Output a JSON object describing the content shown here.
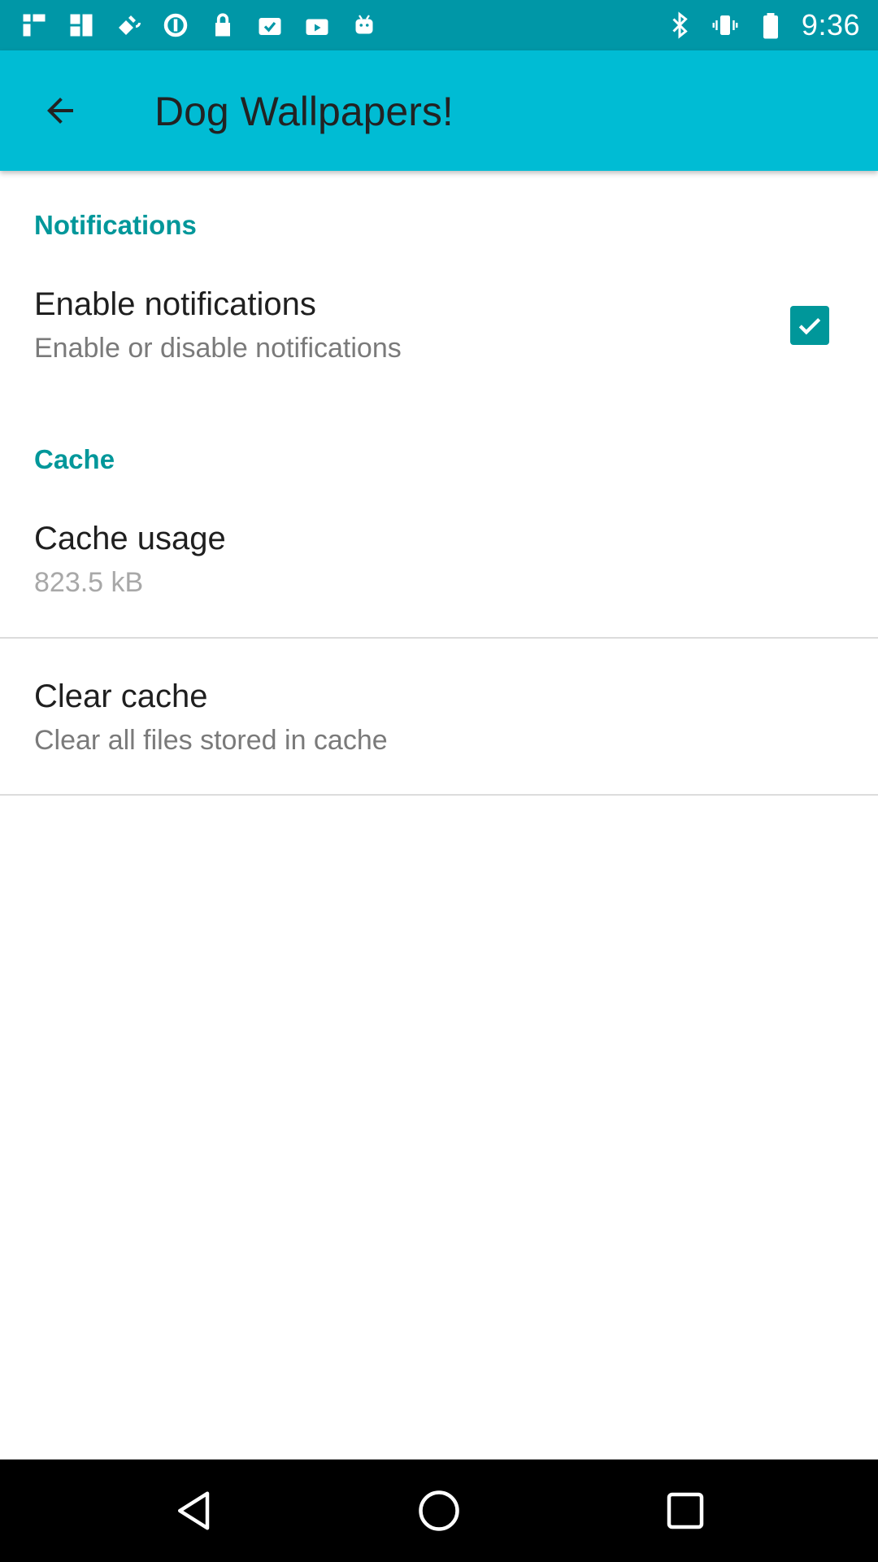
{
  "status_bar": {
    "time": "9:36",
    "left_icons": [
      "signal-icon",
      "signal-alt-icon",
      "satellite-icon",
      "data-saver-icon",
      "lock-icon",
      "task-done-icon",
      "briefcase-icon",
      "android-icon"
    ],
    "right_icons": [
      "bluetooth-icon",
      "vibrate-icon",
      "battery-icon"
    ]
  },
  "app_bar": {
    "title": "Dog Wallpapers!",
    "back_icon": "back-arrow-icon",
    "color": "#00bcd4"
  },
  "settings": {
    "notifications_header": "Notifications",
    "enable_notifications": {
      "title": "Enable notifications",
      "summary": "Enable or disable notifications",
      "checked": true
    },
    "cache_header": "Cache",
    "cache_usage": {
      "title": "Cache usage",
      "summary": "823.5 kB"
    },
    "clear_cache": {
      "title": "Clear cache",
      "summary": "Clear all files stored in cache"
    }
  },
  "nav_bar": {
    "back_icon": "nav-back-icon",
    "home_icon": "nav-home-icon",
    "recents_icon": "nav-recents-icon"
  },
  "colors": {
    "accent": "#00979a",
    "status_bar": "#0097a7",
    "app_bar": "#00bcd4"
  }
}
